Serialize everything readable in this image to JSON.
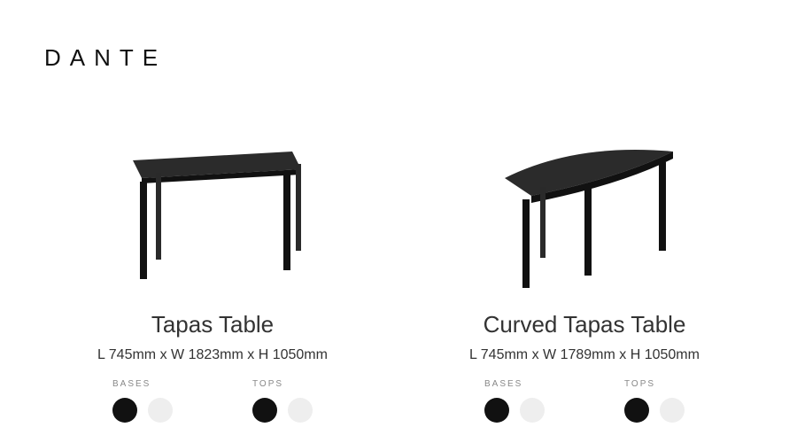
{
  "brand": "DANTE",
  "products": [
    {
      "name": "Tapas Table",
      "dimensions": "L 745mm x W 1823mm x H 1050mm",
      "option_groups": [
        {
          "label": "BASES",
          "swatches": [
            "#111111",
            "#eeeeee"
          ]
        },
        {
          "label": "TOPS",
          "swatches": [
            "#111111",
            "#eeeeee"
          ]
        }
      ]
    },
    {
      "name": "Curved Tapas Table",
      "dimensions": "L 745mm x W 1789mm x H 1050mm",
      "option_groups": [
        {
          "label": "BASES",
          "swatches": [
            "#111111",
            "#eeeeee"
          ]
        },
        {
          "label": "TOPS",
          "swatches": [
            "#111111",
            "#eeeeee"
          ]
        }
      ]
    }
  ]
}
